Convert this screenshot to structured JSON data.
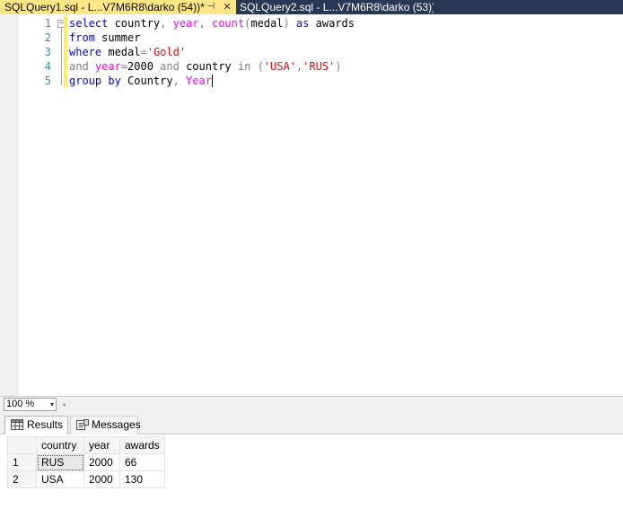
{
  "tabs": [
    {
      "label": "SQLQuery1.sql - L...V7M6R8\\darko (54))*",
      "pin": "⊣",
      "close": "✕"
    },
    {
      "label": "SQLQuery2.sql - L...V7M6R8\\darko (53))*"
    }
  ],
  "editor": {
    "line_numbers": [
      "1",
      "2",
      "3",
      "4",
      "5"
    ],
    "fold": "−",
    "lines": [
      [
        "select",
        " country",
        ",",
        " year",
        ",",
        " count",
        "(",
        "medal",
        ")",
        " as",
        " awards"
      ],
      [
        "from",
        " summer"
      ],
      [
        "where",
        " medal",
        "=",
        "'Gold'"
      ],
      [
        "and",
        " year",
        "=",
        "2000",
        " and",
        " country",
        " in",
        " (",
        "'USA'",
        ",",
        "'RUS'",
        ")"
      ],
      [
        "group by",
        " Country",
        ",",
        " Year"
      ]
    ]
  },
  "zoom": {
    "value": "100 %",
    "dropdown": "▾",
    "scroll_left": "◂"
  },
  "results": {
    "tabs": {
      "results": "Results",
      "messages": "Messages"
    },
    "columns": [
      "country",
      "year",
      "awards"
    ],
    "rows": [
      {
        "n": "1",
        "country": "RUS",
        "year": "2000",
        "awards": "66"
      },
      {
        "n": "2",
        "country": "USA",
        "year": "2000",
        "awards": "130"
      }
    ]
  },
  "colors": {
    "active_tab": "#ffe785",
    "tab_strip": "#293955",
    "keyword": "#0000ff",
    "function": "#ff00ff",
    "string": "#ff0000",
    "operator": "#808080",
    "line_number": "#2b91af",
    "change_bar": "#ffee62"
  }
}
